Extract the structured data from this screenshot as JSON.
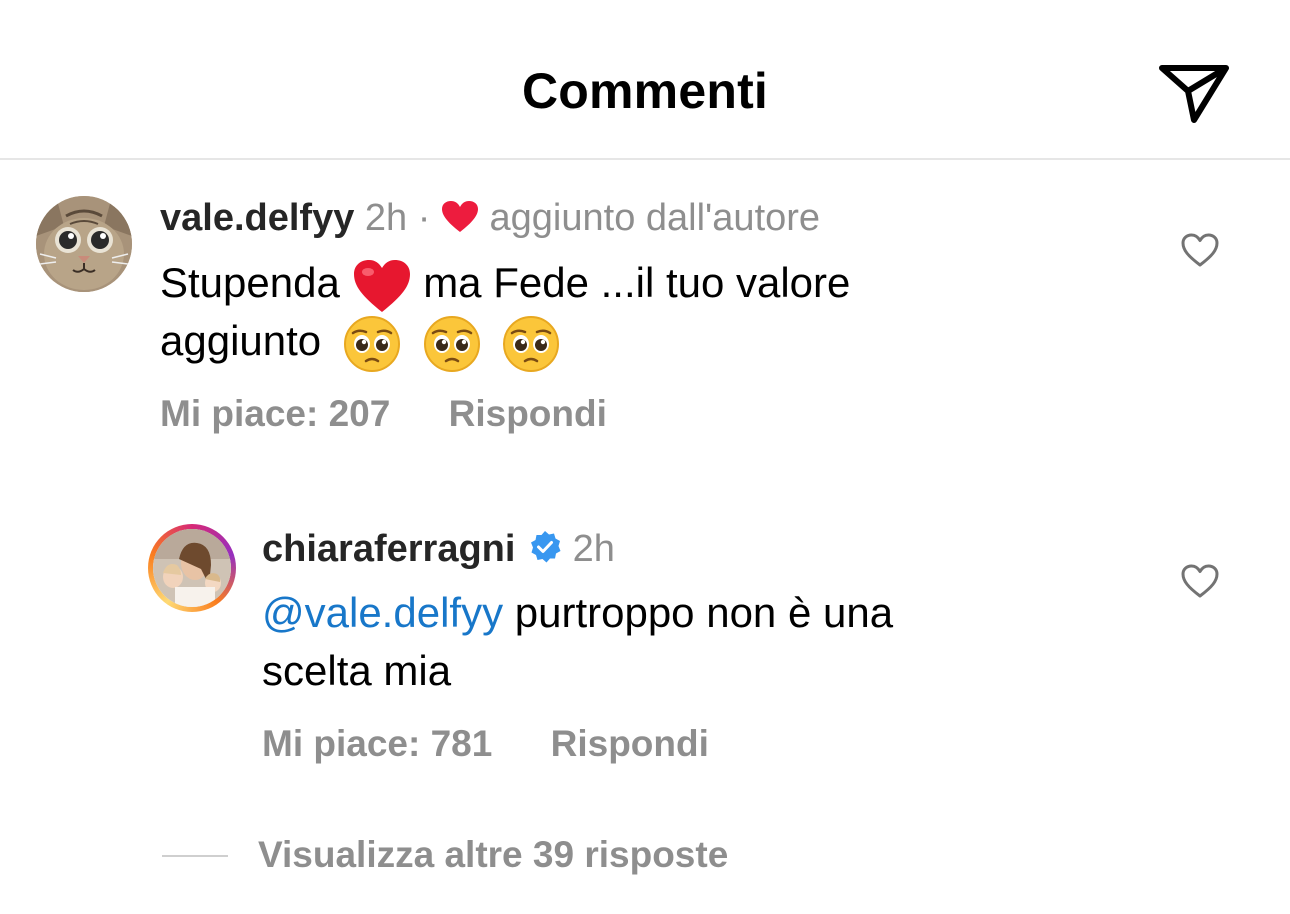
{
  "header": {
    "title": "Commenti",
    "share_icon": "paper-plane-icon"
  },
  "comments": [
    {
      "username": "vale.delfyy",
      "time": "2h",
      "separator": "·",
      "author_like": "aggiunto dall'autore",
      "text_part1": "Stupenda",
      "text_part2": "ma Fede ...il tuo valore",
      "text_part3": "aggiunto",
      "emojis": [
        "heart-emoji",
        "pleading-face-emoji"
      ],
      "likes": "Mi piace: 207",
      "reply": "Rispondi"
    },
    {
      "username": "chiaraferragni",
      "time": "2h",
      "verified_icon": "verified-badge-icon",
      "mention": "@vale.delfyy",
      "text_part1": "purtroppo non è una",
      "text_part2": "scelta mia",
      "likes": "Mi piace: 781",
      "reply": "Rispondi"
    }
  ],
  "view_more": "Visualizza altre 39 risposte",
  "colors": {
    "text": "#000000",
    "secondary": "#8e8e8e",
    "mention": "#1877c9",
    "heart": "#ed1c3e",
    "verified": "#3897f0"
  }
}
